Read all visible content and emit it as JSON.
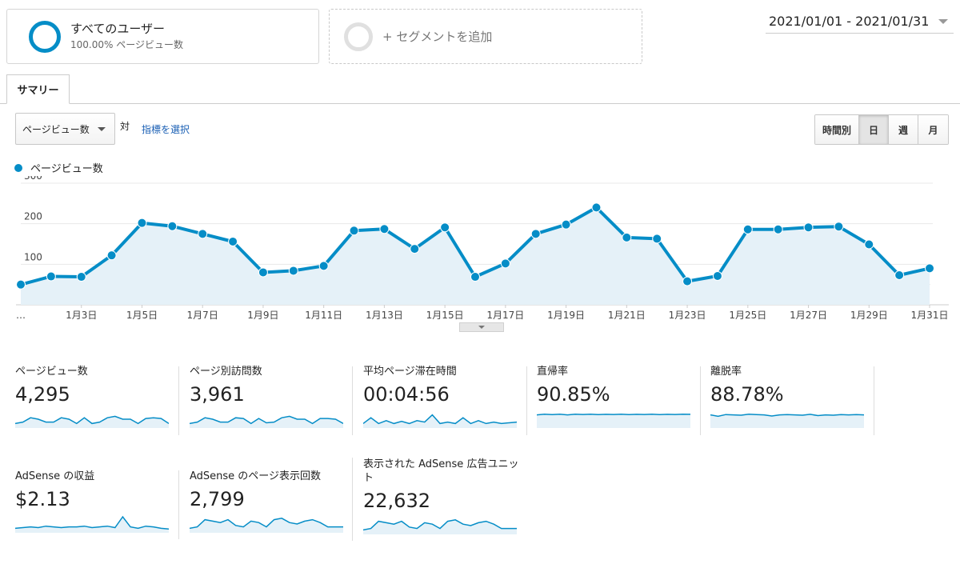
{
  "segments": {
    "active": {
      "title": "すべてのユーザー",
      "subtitle": "100.00% ページビュー数"
    },
    "add": {
      "label": "+ セグメントを追加"
    }
  },
  "date_range": "2021/01/01 - 2021/01/31",
  "tabs": [
    {
      "label": "サマリー"
    }
  ],
  "controls": {
    "metric_selected": "ページビュー数",
    "vs": "対",
    "choose_metric": "指標を選択",
    "granularity": [
      {
        "label": "時間別"
      },
      {
        "label": "日",
        "active": true
      },
      {
        "label": "週"
      },
      {
        "label": "月"
      }
    ]
  },
  "colors": {
    "accent": "#058dc7",
    "area_fill": "#e5f1f8",
    "link": "#1a5fb4"
  },
  "chart_data": {
    "type": "area",
    "series": [
      {
        "name": "ページビュー数",
        "values": [
          50,
          70,
          69,
          122,
          202,
          194,
          175,
          156,
          80,
          84,
          96,
          183,
          187,
          138,
          191,
          69,
          102,
          175,
          198,
          240,
          166,
          163,
          58,
          71,
          186,
          186,
          191,
          193,
          149,
          73,
          90
        ]
      }
    ],
    "x": [
      "1月1日",
      "1月2日",
      "1月3日",
      "1月4日",
      "1月5日",
      "1月6日",
      "1月7日",
      "1月8日",
      "1月9日",
      "1月10日",
      "1月11日",
      "1月12日",
      "1月13日",
      "1月14日",
      "1月15日",
      "1月16日",
      "1月17日",
      "1月18日",
      "1月19日",
      "1月20日",
      "1月21日",
      "1月22日",
      "1月23日",
      "1月24日",
      "1月25日",
      "1月26日",
      "1月27日",
      "1月28日",
      "1月29日",
      "1月30日",
      "1月31日"
    ],
    "x_tick_labels": [
      "…",
      "1月3日",
      "1月5日",
      "1月7日",
      "1月9日",
      "1月11日",
      "1月13日",
      "1月15日",
      "1月17日",
      "1月19日",
      "1月21日",
      "1月23日",
      "1月25日",
      "1月27日",
      "1月29日",
      "1月31日"
    ],
    "y_ticks": [
      100,
      200,
      300
    ],
    "ylim": [
      0,
      300
    ],
    "grid": true,
    "legend": "top-left"
  },
  "metrics": [
    {
      "label": "ページビュー数",
      "value": "4,295",
      "spark": [
        0.2,
        0.3,
        0.6,
        0.5,
        0.3,
        0.3,
        0.6,
        0.5,
        0.2,
        0.6,
        0.2,
        0.3,
        0.6,
        0.7,
        0.5,
        0.5,
        0.2,
        0.55,
        0.6,
        0.55,
        0.2
      ]
    },
    {
      "label": "ページ別訪問数",
      "value": "3,961",
      "spark": [
        0.2,
        0.3,
        0.6,
        0.5,
        0.3,
        0.3,
        0.6,
        0.55,
        0.2,
        0.55,
        0.25,
        0.3,
        0.6,
        0.7,
        0.5,
        0.5,
        0.2,
        0.55,
        0.55,
        0.5,
        0.2
      ]
    },
    {
      "label": "平均ページ滞在時間",
      "value": "00:04:56",
      "spark": [
        0.2,
        0.6,
        0.2,
        0.4,
        0.2,
        0.35,
        0.2,
        0.4,
        0.3,
        0.8,
        0.2,
        0.3,
        0.2,
        0.6,
        0.2,
        0.4,
        0.2,
        0.3,
        0.2,
        0.25,
        0.3
      ]
    },
    {
      "label": "直帰率",
      "value": "90.85%",
      "spark": [
        0.8,
        0.85,
        0.82,
        0.85,
        0.8,
        0.85,
        0.83,
        0.85,
        0.82,
        0.84,
        0.83,
        0.85,
        0.82,
        0.84,
        0.83,
        0.85,
        0.82,
        0.84,
        0.83,
        0.85,
        0.84
      ]
    },
    {
      "label": "離脱率",
      "value": "88.78%",
      "spark": [
        0.8,
        0.7,
        0.82,
        0.8,
        0.78,
        0.85,
        0.82,
        0.8,
        0.72,
        0.8,
        0.82,
        0.8,
        0.78,
        0.84,
        0.75,
        0.8,
        0.78,
        0.82,
        0.8,
        0.82,
        0.8
      ]
    },
    {
      "label": "AdSense の収益",
      "value": "$2.13",
      "spark": [
        0.2,
        0.25,
        0.3,
        0.25,
        0.35,
        0.3,
        0.25,
        0.3,
        0.3,
        0.35,
        0.25,
        0.3,
        0.35,
        0.25,
        1.0,
        0.3,
        0.2,
        0.35,
        0.3,
        0.2,
        0.15
      ]
    },
    {
      "label": "AdSense のページ表示回数",
      "value": "2,799",
      "spark": [
        0.2,
        0.3,
        0.8,
        0.7,
        0.6,
        0.8,
        0.4,
        0.3,
        0.7,
        0.6,
        0.3,
        0.8,
        0.9,
        0.6,
        0.5,
        0.7,
        0.8,
        0.6,
        0.3,
        0.3,
        0.3
      ]
    },
    {
      "label": "表示された AdSense 広告ユニット",
      "value": "22,632",
      "spark": [
        0.2,
        0.3,
        0.8,
        0.7,
        0.6,
        0.8,
        0.4,
        0.3,
        0.7,
        0.6,
        0.3,
        0.8,
        0.9,
        0.6,
        0.5,
        0.7,
        0.8,
        0.6,
        0.3,
        0.3,
        0.3
      ]
    }
  ]
}
